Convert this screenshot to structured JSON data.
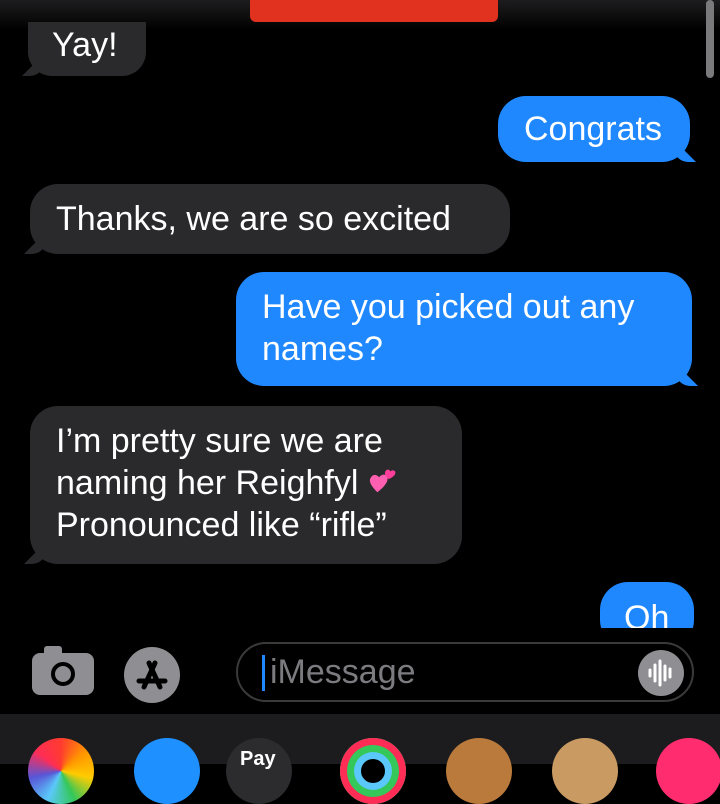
{
  "messages": [
    {
      "id": "m1",
      "direction": "incoming",
      "text": "Yay!"
    },
    {
      "id": "m2",
      "direction": "outgoing",
      "text": "Congrats"
    },
    {
      "id": "m3",
      "direction": "incoming",
      "text": "Thanks, we are so excited"
    },
    {
      "id": "m4",
      "direction": "outgoing",
      "line1": "Have you picked out any",
      "line2": "names?"
    },
    {
      "id": "m5",
      "direction": "incoming",
      "line1": "I’m pretty sure we are",
      "line2": "naming her Reighfyl",
      "emoji_icon": "two-hearts-icon",
      "line3": "Pronounced like “rifle”"
    },
    {
      "id": "m6",
      "direction": "outgoing",
      "text": "Oh"
    }
  ],
  "input": {
    "placeholder": "iMessage",
    "camera_icon": "camera-icon",
    "apps_icon": "app-store-icon",
    "audio_icon": "audio-waveform-icon"
  },
  "tray": {
    "pay_label": "Pay",
    "icons": [
      "photos-icon",
      "app-store-icon",
      "apple-pay-icon",
      "activity-rings-icon",
      "memoji-icon",
      "monkey-icon",
      "hearts-icon"
    ]
  },
  "colors": {
    "background": "#000000",
    "incoming_bubble": "#2a2a2c",
    "outgoing_bubble": "#1f88ff",
    "redaction": "#e0321e"
  }
}
